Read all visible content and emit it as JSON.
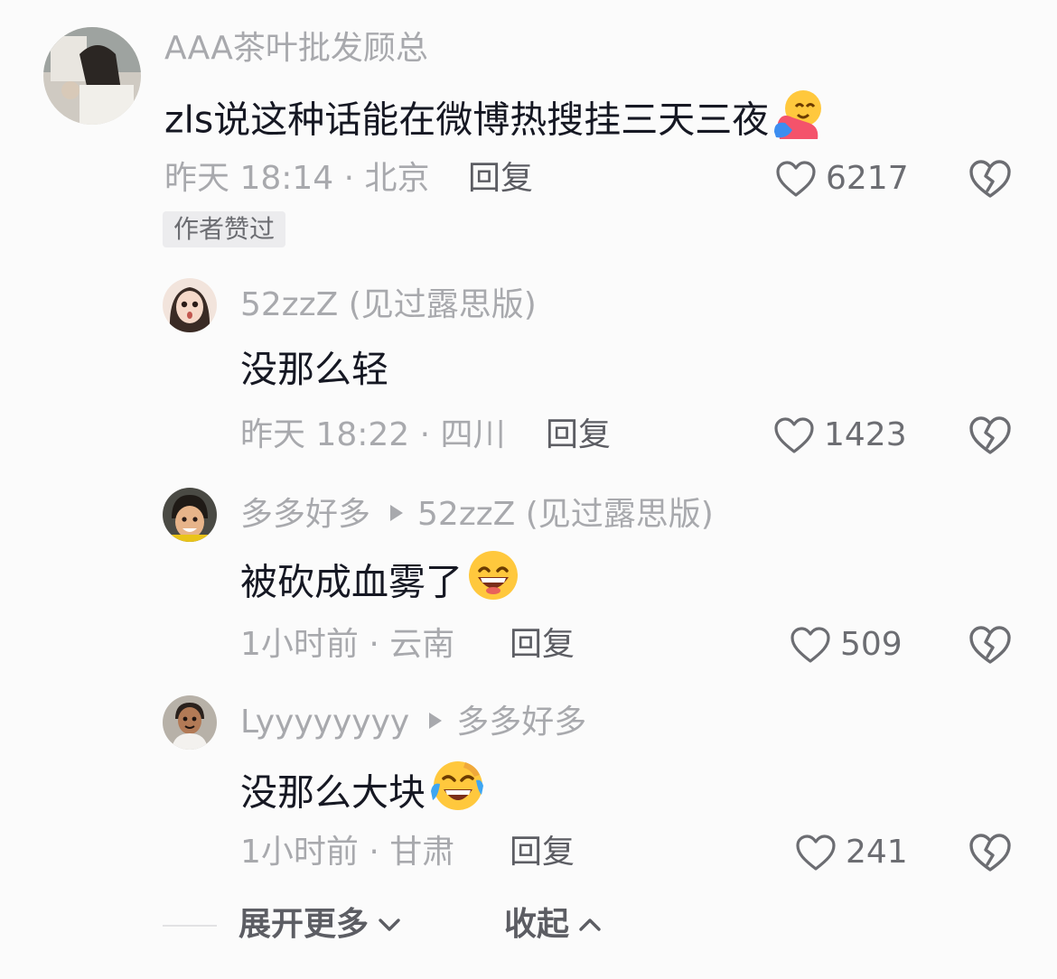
{
  "main_comment": {
    "username": "AAA茶叶批发顾总",
    "text": "zls说这种话能在微博热搜挂三天三夜",
    "emoji": "hugging-face",
    "time": "昨天 18:14 · 北京",
    "reply_label": "回复",
    "likes": "6217",
    "badge": "作者赞过"
  },
  "replies": [
    {
      "username": "52zzZ (见过露思版)",
      "reply_to": "",
      "text": "没那么轻",
      "emoji": "",
      "time": "昨天 18:22 · 四川",
      "reply_label": "回复",
      "likes": "1423"
    },
    {
      "username": "多多好多",
      "reply_to": "52zzZ (见过露思版)",
      "text": "被砍成血雾了",
      "emoji": "grinning-face",
      "time": "1小时前 · 云南",
      "reply_label": "回复",
      "likes": "509"
    },
    {
      "username": "Lyyyyyyyy",
      "reply_to": "多多好多",
      "text": "没那么大块",
      "emoji": "laughing-crying-face",
      "time": "1小时前 · 甘肃",
      "reply_label": "回复",
      "likes": "241"
    }
  ],
  "footer": {
    "expand_label": "展开更多",
    "collapse_label": "收起"
  },
  "icons": {
    "like": "heart-outline-icon",
    "dislike": "broken-heart-icon",
    "expand": "chevron-down-icon",
    "collapse": "chevron-up-icon"
  },
  "colors": {
    "background": "#fbfbfb",
    "text": "#161823",
    "secondary": "#a8a9ad",
    "reply": "#5c5d63"
  }
}
